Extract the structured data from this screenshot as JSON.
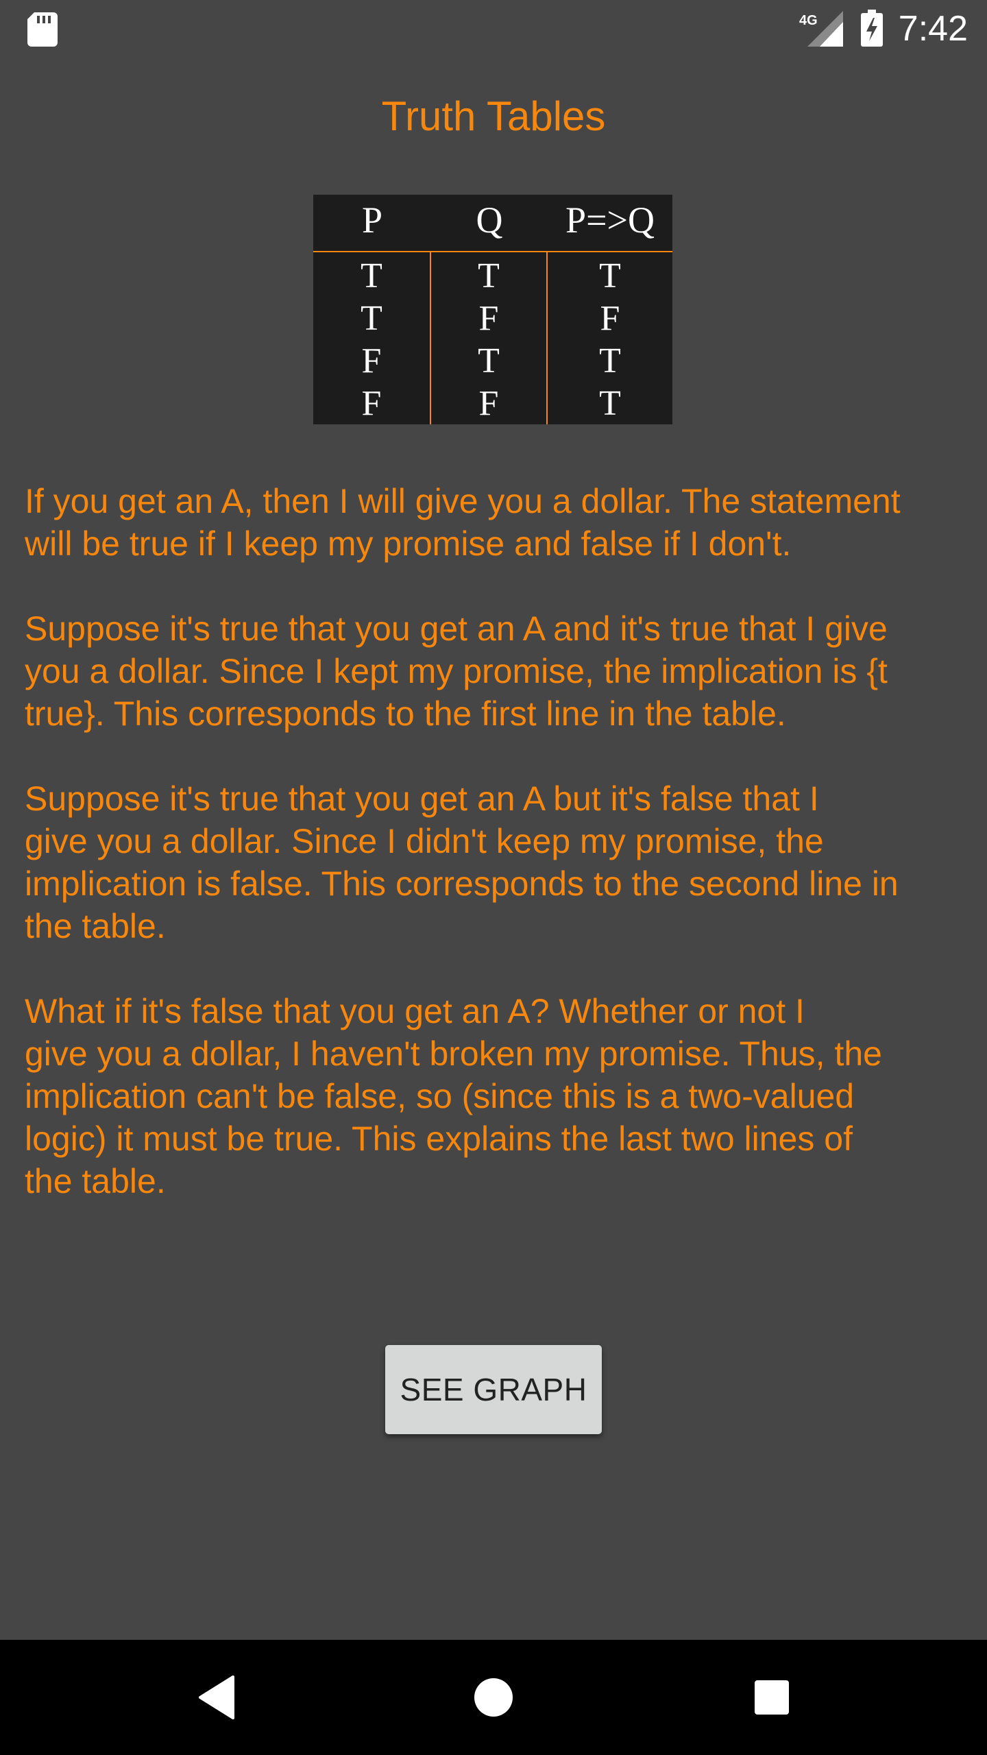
{
  "status_bar": {
    "network_label": "4G",
    "time": "7:42",
    "icons": [
      "sd-card-icon",
      "cell-signal-icon",
      "battery-charging-icon"
    ]
  },
  "page": {
    "title": "Truth Tables"
  },
  "truth_table": {
    "headers": [
      "P",
      "Q",
      "P=>Q"
    ],
    "rows": [
      [
        "T",
        "T",
        "T"
      ],
      [
        "T",
        "F",
        "F"
      ],
      [
        "F",
        "T",
        "T"
      ],
      [
        "F",
        "F",
        "T"
      ]
    ]
  },
  "paragraphs": [
    "If you get an A, then I will give you a dollar. The statement\nwill be true if I keep my promise and false if I don't.",
    "Suppose it's true that you get an A and it's true that I give\nyou a dollar. Since I kept my promise, the implication is {t\ntrue}. This corresponds to the first line in the table.",
    "Suppose it's true that you get an A but it's false that I\ngive you a dollar. Since I didn't keep my promise, the\nimplication is false. This corresponds to the second line in\nthe table.",
    "What if it's false that you get an A? Whether or not I\ngive you a dollar, I haven't broken my promise. Thus, the\nimplication can't be false, so (since this is a two-valued\nlogic) it must be true. This explains the last two lines of\nthe table."
  ],
  "button": {
    "label": "SEE GRAPH"
  },
  "nav_bar": {
    "icons": [
      "back-icon",
      "home-icon",
      "recent-apps-icon"
    ]
  },
  "colors": {
    "background": "#464646",
    "accent": "#f7870d",
    "table_background": "#1c1c1c",
    "button_background": "#d6d7d7",
    "nav_background": "#000000"
  }
}
